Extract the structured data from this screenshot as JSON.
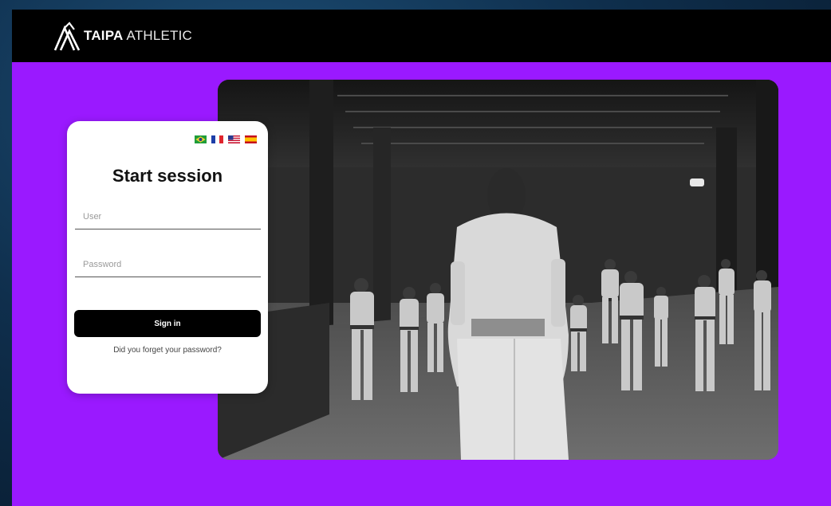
{
  "header": {
    "brand_bold": "TAIPA",
    "brand_light": "ATHLETIC",
    "logo_icon": "mountain-peaks-logo-icon"
  },
  "login": {
    "title": "Start session",
    "user_placeholder": "User",
    "password_placeholder": "Password",
    "signin_label": "Sign in",
    "forgot_label": "Did you forget your password?",
    "languages": [
      {
        "name": "brazil-flag-icon"
      },
      {
        "name": "france-flag-icon"
      },
      {
        "name": "usa-flag-icon"
      },
      {
        "name": "spain-flag-icon"
      }
    ]
  },
  "colors": {
    "page_background": "#9a19ff",
    "header_background": "#000000",
    "card_background": "#ffffff",
    "button_background": "#000000"
  }
}
